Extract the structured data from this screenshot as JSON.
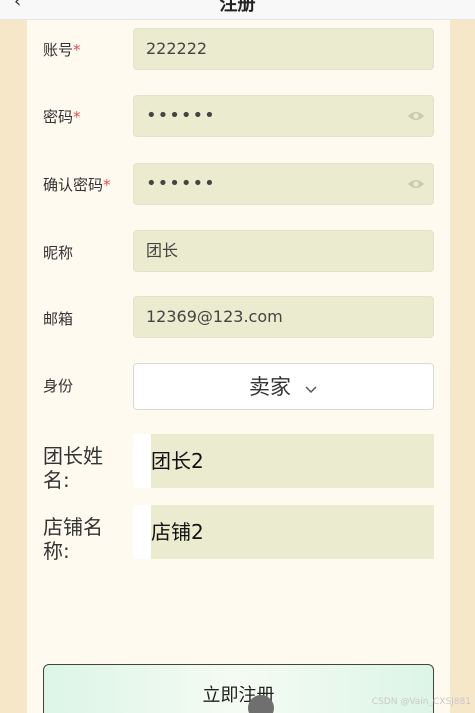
{
  "header": {
    "title": "注册",
    "back_icon": "back-arrow-icon"
  },
  "form": {
    "account": {
      "label": "账号",
      "required_mark": "*",
      "value": "222222"
    },
    "password": {
      "label": "密码",
      "required_mark": "*",
      "value": "••••••",
      "toggle_icon": "eye-icon"
    },
    "confirm_password": {
      "label": "确认密码",
      "required_mark": "*",
      "value": "••••••",
      "toggle_icon": "eye-icon"
    },
    "nickname": {
      "label": "昵称",
      "value": "团长"
    },
    "email": {
      "label": "邮箱",
      "value": "12369@123.com"
    },
    "identity": {
      "label": "身份",
      "value": "卖家",
      "icon": "chevron-down-icon"
    },
    "leader_name": {
      "label": "团长姓名:",
      "value": "团长2"
    },
    "shop_name": {
      "label": "店铺名称:",
      "value": "店铺2"
    }
  },
  "submit": {
    "label": "立即注册"
  },
  "watermark": "CSDN @Vain_CXSJ881",
  "colors": {
    "background": "#f7e7c9",
    "card": "#fffaf0",
    "input": "#ebebd0",
    "required": "#e05050"
  }
}
